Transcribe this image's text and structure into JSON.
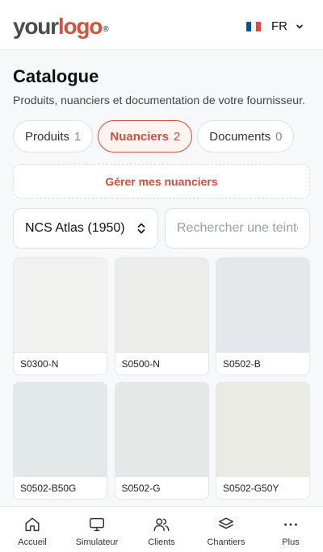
{
  "header": {
    "logo_your": "your",
    "logo_logo": "logo",
    "logo_mark": "®",
    "language": "FR",
    "flag_colors": [
      "#0055a4",
      "#ffffff",
      "#ef4135"
    ]
  },
  "page": {
    "title": "Catalogue",
    "subtitle": "Produits, nuanciers et documentation de votre fournisseur."
  },
  "tabs": [
    {
      "label": "Produits",
      "count": "1",
      "active": false
    },
    {
      "label": "Nuanciers",
      "count": "2",
      "active": true
    },
    {
      "label": "Documents",
      "count": "0",
      "active": false
    }
  ],
  "manage_button": "Gérer mes nuanciers",
  "palette_select": {
    "value": "NCS Atlas (1950)"
  },
  "search": {
    "placeholder": "Rechercher une teinte"
  },
  "swatches": [
    {
      "code": "S0300-N",
      "color": "#f1f1ef"
    },
    {
      "code": "S0500-N",
      "color": "#ececea"
    },
    {
      "code": "S0502-B",
      "color": "#e4e8eb"
    },
    {
      "code": "S0502-B50G",
      "color": "#e3e9e8"
    },
    {
      "code": "S0502-G",
      "color": "#e4e9e7"
    },
    {
      "code": "S0502-G50Y",
      "color": "#e9ebe4"
    }
  ],
  "nav": [
    {
      "label": "Accueil",
      "icon": "home-icon"
    },
    {
      "label": "Simulateur",
      "icon": "monitor-icon"
    },
    {
      "label": "Clients",
      "icon": "users-icon"
    },
    {
      "label": "Chantiers",
      "icon": "layers-icon"
    },
    {
      "label": "Plus",
      "icon": "more-icon"
    }
  ],
  "colors": {
    "accent": "#c9503c"
  }
}
